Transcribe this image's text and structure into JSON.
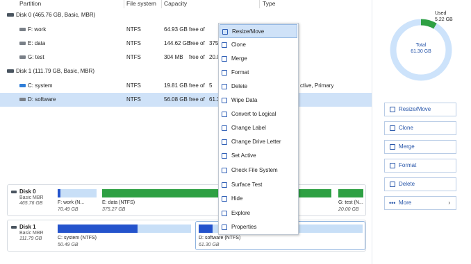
{
  "columns": {
    "partition": "Partition",
    "fs": "File system",
    "capacity": "Capacity",
    "type": "Type"
  },
  "rows": [
    {
      "kind": "disk",
      "name": "Disk 0 (465.76 GB, Basic, MBR)"
    },
    {
      "kind": "part",
      "name": "F: work",
      "fs": "NTFS",
      "cap": "64.93 GB",
      "free_of": "free of",
      "rest": "",
      "type": ""
    },
    {
      "kind": "part",
      "name": "E: data",
      "fs": "NTFS",
      "cap": "144.62 GB",
      "free_of": "free of",
      "rest": "375",
      "type": ""
    },
    {
      "kind": "part",
      "name": "G: test",
      "fs": "NTFS",
      "cap": "304 MB",
      "free_of": "free of",
      "rest": "20.0",
      "type": ""
    },
    {
      "kind": "disk",
      "name": "Disk 1 (111.79 GB, Basic, MBR)"
    },
    {
      "kind": "part",
      "name": "C: system",
      "fs": "NTFS",
      "cap": "19.81 GB",
      "free_of": "free of",
      "rest": "5",
      "type": "ctive, Primary"
    },
    {
      "kind": "part",
      "name": "D: software",
      "fs": "NTFS",
      "cap": "56.08 GB",
      "free_of": "free of",
      "rest": "61.3",
      "type": "",
      "selected": true
    }
  ],
  "context_menu": [
    {
      "label": "Resize/Move",
      "icon": "resize-icon"
    },
    {
      "label": "Clone",
      "icon": "clone-icon"
    },
    {
      "label": "Merge",
      "icon": "merge-icon"
    },
    {
      "label": "Format",
      "icon": "format-icon"
    },
    {
      "label": "Delete",
      "icon": "trash-icon"
    },
    {
      "label": "Wipe Data",
      "icon": "wipe-icon"
    },
    {
      "label": "Convert to Logical",
      "icon": "convert-icon"
    },
    {
      "label": "Change Label",
      "icon": "tag-icon"
    },
    {
      "label": "Change Drive Letter",
      "icon": "drive-letter-icon"
    },
    {
      "label": "Set Active",
      "icon": "check-icon"
    },
    {
      "label": "Check File System",
      "icon": "checklist-icon"
    },
    {
      "label": "Surface Test",
      "icon": "surface-icon"
    },
    {
      "label": "Hide",
      "icon": "eye-off-icon"
    },
    {
      "label": "Explore",
      "icon": "explore-icon"
    },
    {
      "label": "Properties",
      "icon": "properties-icon"
    }
  ],
  "usage": {
    "used_label": "Used",
    "used_value": "5.22 GB",
    "total_label": "Total",
    "total_value": "61.30 GB",
    "used_fraction": 0.085,
    "colors": {
      "used": "#2ea043",
      "free": "#cde3fb"
    }
  },
  "actions": [
    {
      "label": "Resize/Move",
      "icon": "resize-icon"
    },
    {
      "label": "Clone",
      "icon": "clone-icon"
    },
    {
      "label": "Merge",
      "icon": "merge-icon"
    },
    {
      "label": "Format",
      "icon": "format-icon"
    },
    {
      "label": "Delete",
      "icon": "trash-icon"
    },
    {
      "label": "More",
      "icon": "more-icon"
    }
  ],
  "disk_maps": [
    {
      "title": "Disk 0",
      "sub1": "Basic MBR",
      "sub2": "465.76 GB",
      "parts": [
        {
          "name": "F: work (N...",
          "size": "70.49 GB",
          "fill": 0.08
        },
        {
          "name": "E: data (NTFS)",
          "size": "375.27 GB",
          "fill": 1.0
        },
        {
          "name": "G: test (N...",
          "size": "20.00 GB",
          "fill": 1.0
        }
      ]
    },
    {
      "title": "Disk 1",
      "sub1": "Basic MBR",
      "sub2": "111.79 GB",
      "parts": [
        {
          "name": "C: system (NTFS)",
          "size": "50.49 GB",
          "fill": 0.6
        },
        {
          "name": "D: software (NTFS)",
          "size": "61.30 GB",
          "fill": 0.085
        }
      ]
    }
  ]
}
